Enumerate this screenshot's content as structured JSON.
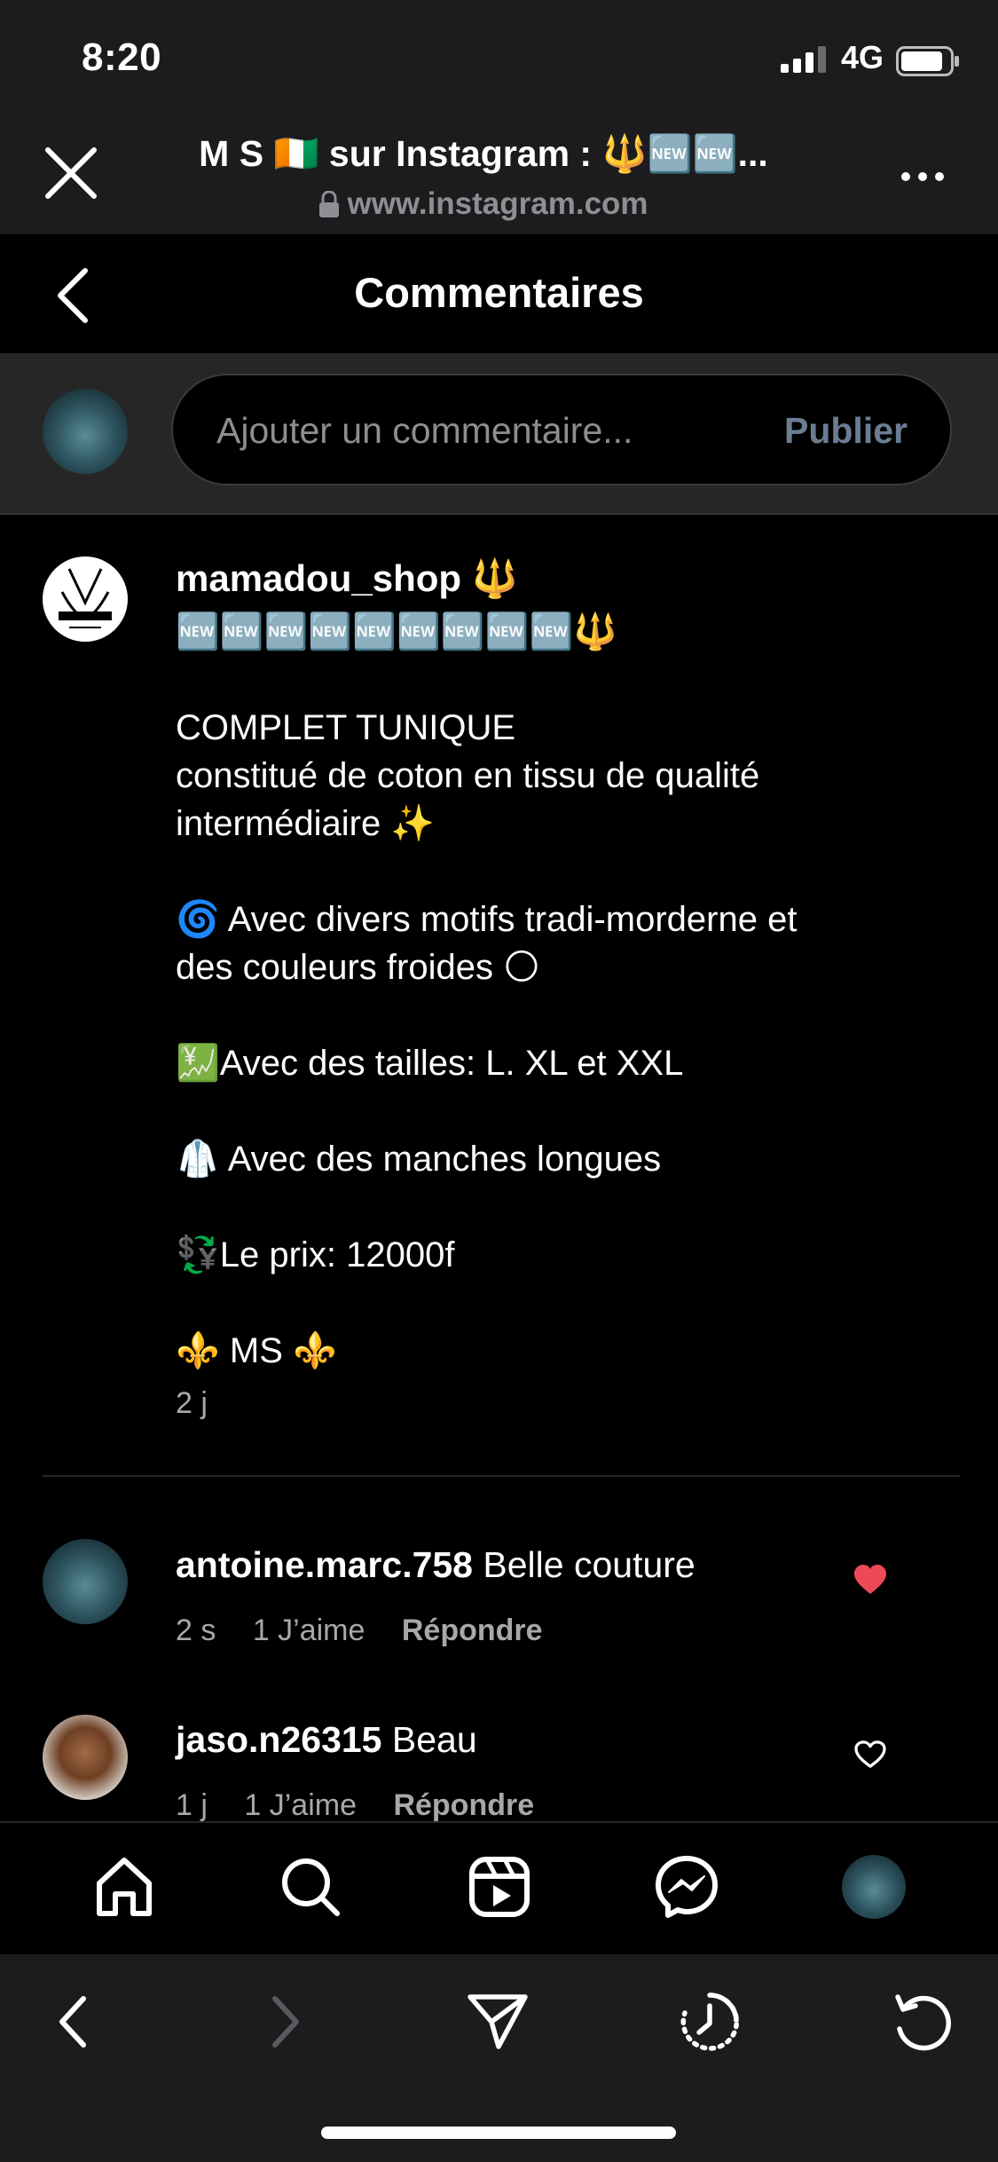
{
  "status_bar": {
    "time": "8:20",
    "network": "4G"
  },
  "browser": {
    "page_title": "M S 🇨🇮 sur Instagram : 🔱🆕🆕...",
    "url": "www.instagram.com"
  },
  "header": {
    "title": "Commentaires"
  },
  "add_comment": {
    "placeholder": "Ajouter un commentaire...",
    "publish_label": "Publier"
  },
  "caption": {
    "username": "mamadou_shop 🔱",
    "lines": [
      "🆕🆕🆕🆕🆕🆕🆕🆕🆕🔱",
      "",
      "COMPLET TUNIQUE",
      "constitué de coton en tissu de qualité",
      "intermédiaire ✨",
      "",
      "🌀 Avec divers motifs tradi-morderne et",
      "des couleurs froides 🌕",
      "",
      "💹Avec des tailles: L. XL et XXL",
      "",
      "🥼 Avec des manches longues",
      "",
      "💱Le prix: 12000f",
      "",
      "⚜️ MS ⚜️"
    ],
    "time": "2 j"
  },
  "comments": [
    {
      "username": "antoine.marc.758",
      "text": "Belle couture",
      "time": "2 s",
      "likes": "1 J’aime",
      "reply": "Répondre",
      "liked": true
    },
    {
      "username": "jaso.n26315",
      "text": "Beau",
      "time": "1 j",
      "likes": "1 J’aime",
      "reply": "Répondre",
      "liked": false
    }
  ],
  "colors": {
    "like_red": "#ed4956",
    "publish_muted": "#6b7d93",
    "chrome_bg": "#1c1c1e"
  },
  "nav_icons": [
    "home-icon",
    "search-icon",
    "reels-icon",
    "messenger-icon",
    "profile-avatar"
  ],
  "browser_icons": [
    "back-icon",
    "forward-icon",
    "share-icon",
    "history-icon",
    "reload-icon"
  ]
}
